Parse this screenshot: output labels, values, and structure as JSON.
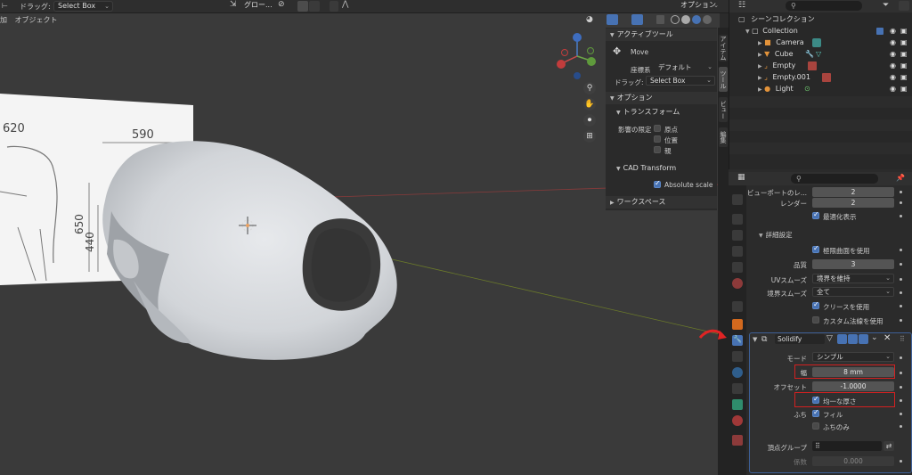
{
  "topbar": {
    "menu_glyph": "⊢",
    "drag_label": "ドラッグ:",
    "drag_value": "Select Box",
    "orientation_value": "グロー...",
    "options_label": "オプション"
  },
  "viewport_menu": {
    "add": "加",
    "object": "オブジェクト"
  },
  "reference_image": {
    "dim_top_left": "620",
    "dim_top_right": "590",
    "dim_side_1": "650",
    "dim_side_2": "440"
  },
  "npanel": {
    "active_tool_header": "アクティブツール",
    "tool_name": "Move",
    "orientation_label": "座標系",
    "orientation_value": "デフォルト",
    "drag_label": "ドラッグ:",
    "drag_value": "Select Box",
    "options_header": "オプション",
    "transform_header": "トランスフォーム",
    "affect_only_label": "影響の限定",
    "affect_origins": "原点",
    "affect_locations": "位置",
    "affect_parents": "親",
    "cad_header": "CAD Transform",
    "absolute_scale": "Absolute scale",
    "workspace_header": "ワークスペース"
  },
  "ntabs": [
    "アイテム",
    "ツール",
    "ビュー",
    "編集"
  ],
  "outliner": {
    "title": "シーンコレクション",
    "collection": "Collection",
    "items": [
      {
        "name": "Camera",
        "icon": "camera-icon"
      },
      {
        "name": "Cube",
        "icon": "mesh-icon"
      },
      {
        "name": "Empty",
        "icon": "empty-icon"
      },
      {
        "name": "Empty.001",
        "icon": "empty-icon"
      },
      {
        "name": "Light",
        "icon": "light-icon"
      }
    ]
  },
  "subdivision": {
    "viewport_label": "ビューポートのレ...",
    "viewport_value": "2",
    "render_label": "レンダー",
    "render_value": "2",
    "optimal_display": "最適化表示",
    "advanced_header": "詳細設定",
    "use_limit_surface": "極限曲面を使用",
    "quality_label": "品質",
    "quality_value": "3",
    "uv_smooth_label": "UVスムーズ",
    "uv_smooth_value": "境界を維持",
    "boundary_smooth_label": "境界スムーズ",
    "boundary_smooth_value": "全て",
    "use_creases": "クリースを使用",
    "custom_normals": "カスタム法線を使用"
  },
  "solidify": {
    "name": "Solidify",
    "mode_label": "モード",
    "mode_value": "シンプル",
    "thickness_label": "幅",
    "thickness_value": "8 mm",
    "offset_label": "オフセット",
    "offset_value": "-1.0000",
    "even_thickness": "均一な厚さ",
    "rim_label": "ふち",
    "rim_fill": "フィル",
    "rim_only": "ふちのみ",
    "vertex_group_label": "頂点グループ",
    "factor_label": "係数",
    "factor_value": "0.000"
  },
  "colors": {
    "accent": "#4772b3",
    "highlight": "#d32121",
    "arrow": "#e02424"
  }
}
